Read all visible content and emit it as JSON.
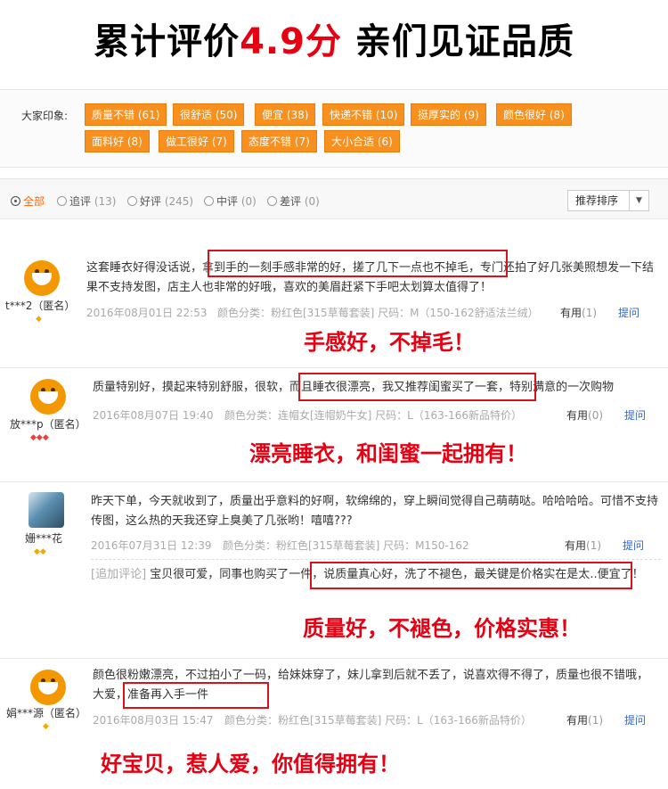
{
  "banner": {
    "prefix": "累计评价",
    "score": "4.9分",
    "suffix": " 亲们见证品质"
  },
  "impressions": {
    "label": "大家印象:",
    "tags": [
      "质量不错 (61)",
      "很舒适 (50)",
      "便宜 (38)",
      "快递不错 (10)",
      "挺厚实的 (9)",
      "颜色很好 (8)",
      "面料好 (8)",
      "做工很好 (7)",
      "态度不错 (7)",
      "大小合适 (6)"
    ]
  },
  "filter": {
    "options": [
      {
        "label": "全部",
        "count": ""
      },
      {
        "label": "追评",
        "count": "(13)"
      },
      {
        "label": "好评",
        "count": "(245)"
      },
      {
        "label": "中评",
        "count": "(0)"
      },
      {
        "label": "差评",
        "count": "(0)"
      }
    ],
    "sort_label": "推荐排序",
    "sort_arrow": "▼"
  },
  "reviews": [
    {
      "nick": "t***2（匿名）",
      "badge": "◆",
      "text_a": "这套睡衣好得没话说，",
      "text_b": "拿到手的一刻手感非常的好，搓了几下一点也不掉毛，",
      "text_c": "专门还拍了好几张美照想发一下结果不支持发图，店主人也非常的好哦，喜欢的美眉赶紧下手吧太划算太值得了！",
      "date": "2016年08月01日 22:53",
      "spec": "颜色分类：粉红色[315草莓套装]  尺码：M（150-162舒适法兰绒）",
      "useful": "有用",
      "useful_count": "(1)",
      "ask": "提问",
      "slogan": "手感好，不掉毛！"
    },
    {
      "nick": "放***p（匿名）",
      "badge": "◆◆◆",
      "text_a": "质量特别好，摸起来特别舒服，很软，",
      "text_b": "而且睡衣很漂亮，我又推荐闺蜜买了一套，",
      "text_c": "特别满意的一次购物",
      "date": "2016年08月07日 19:40",
      "spec": "颜色分类：连帽女[连帽奶牛女]  尺码：L（163-166新品特价）",
      "useful": "有用",
      "useful_count": "(0)",
      "ask": "提问",
      "slogan": "漂亮睡衣，和闺蜜一起拥有！"
    },
    {
      "nick": "姗***花",
      "badge": "◆◆",
      "text": "昨天下单，今天就收到了，质量出乎意料的好啊，软绵绵的，穿上瞬间觉得自己萌萌哒。哈哈哈哈。可惜不支持传图，这么热的天我还穿上臭美了几张哟！嘻嘻???",
      "date": "2016年07月31日 12:39",
      "spec": "颜色分类：粉红色[315草莓套装]  尺码：M150-162",
      "useful": "有用",
      "useful_count": "(1)",
      "ask": "提问",
      "followup_tag": "[追加评论]",
      "followup_a": " 宝贝很可爱，同事也购买了一件，",
      "followup_b": "说质量真心好，洗了不褪色，最关键是价格实在是太",
      "followup_c": "..便宜了！",
      "slogan": "质量好，不褪色，价格实惠！"
    },
    {
      "nick": "娟***源（匿名）",
      "badge": "◆",
      "text_a": "颜色很粉嫩漂亮，不过拍小了一码，给妹妹穿了，妹儿拿到后就不丢了，说喜欢得不得了，质量也很不错哦，",
      "text_b": "大爱，准备再入手一件",
      "date": "2016年08月03日 15:47",
      "spec": "颜色分类：粉红色[315草莓套装]  尺码：L（163-166新品特价）",
      "useful": "有用",
      "useful_count": "(1)",
      "ask": "提问",
      "slogan": "好宝贝，惹人爱，你值得拥有！"
    }
  ]
}
